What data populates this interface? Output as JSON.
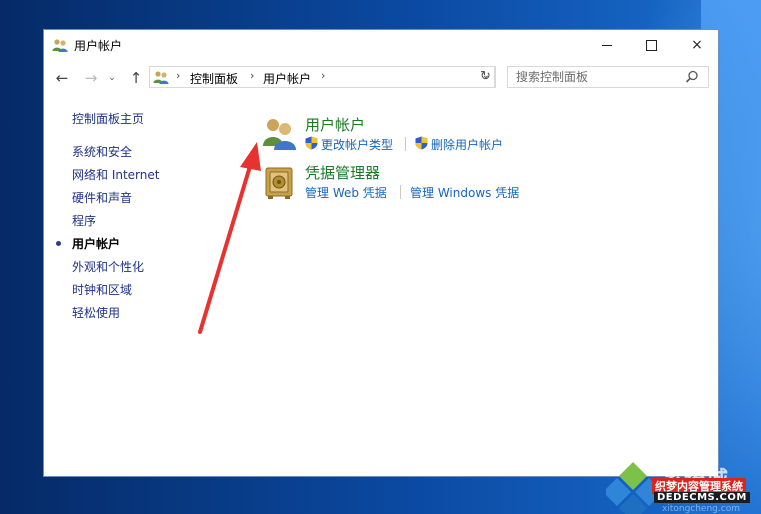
{
  "window": {
    "title": "用户帐户",
    "icon": "users-icon",
    "controls": {
      "minimize": "minimize-icon",
      "maximize": "maximize-icon",
      "close": "×"
    }
  },
  "nav": {
    "back": "←",
    "forward": "→",
    "recent": "⌄",
    "up": "↑",
    "breadcrumb": [
      "控制面板",
      "用户帐户"
    ],
    "separator": "›",
    "dropdown": "⌄",
    "refresh": "↻",
    "search_placeholder": "搜索控制面板"
  },
  "sidebar": {
    "home": "控制面板主页",
    "items": [
      {
        "label": "系统和安全",
        "current": false
      },
      {
        "label": "网络和 Internet",
        "current": false
      },
      {
        "label": "硬件和声音",
        "current": false
      },
      {
        "label": "程序",
        "current": false
      },
      {
        "label": "用户帐户",
        "current": true
      },
      {
        "label": "外观和个性化",
        "current": false
      },
      {
        "label": "时钟和区域",
        "current": false
      },
      {
        "label": "轻松使用",
        "current": false
      }
    ]
  },
  "categories": [
    {
      "title": "用户帐户",
      "icon": "user-accounts-icon",
      "tasks": [
        {
          "label": "更改帐户类型",
          "shield": true
        },
        {
          "label": "删除用户帐户",
          "shield": true
        }
      ]
    },
    {
      "title": "凭据管理器",
      "icon": "credential-vault-icon",
      "tasks": [
        {
          "label": "管理 Web 凭据",
          "shield": false
        },
        {
          "label": "管理 Windows 凭据",
          "shield": false
        }
      ]
    }
  ],
  "annotation": {
    "color": "#e8322f"
  },
  "watermark": {
    "big_text": "系统城",
    "red_text": "织梦内容管理系统",
    "url_text": "DEDECMS.COM",
    "sub_text": "xitongcheng.com"
  },
  "colors": {
    "link": "#1565c0",
    "category_title": "#1a7a25",
    "sidebar_link": "#1e3287"
  }
}
